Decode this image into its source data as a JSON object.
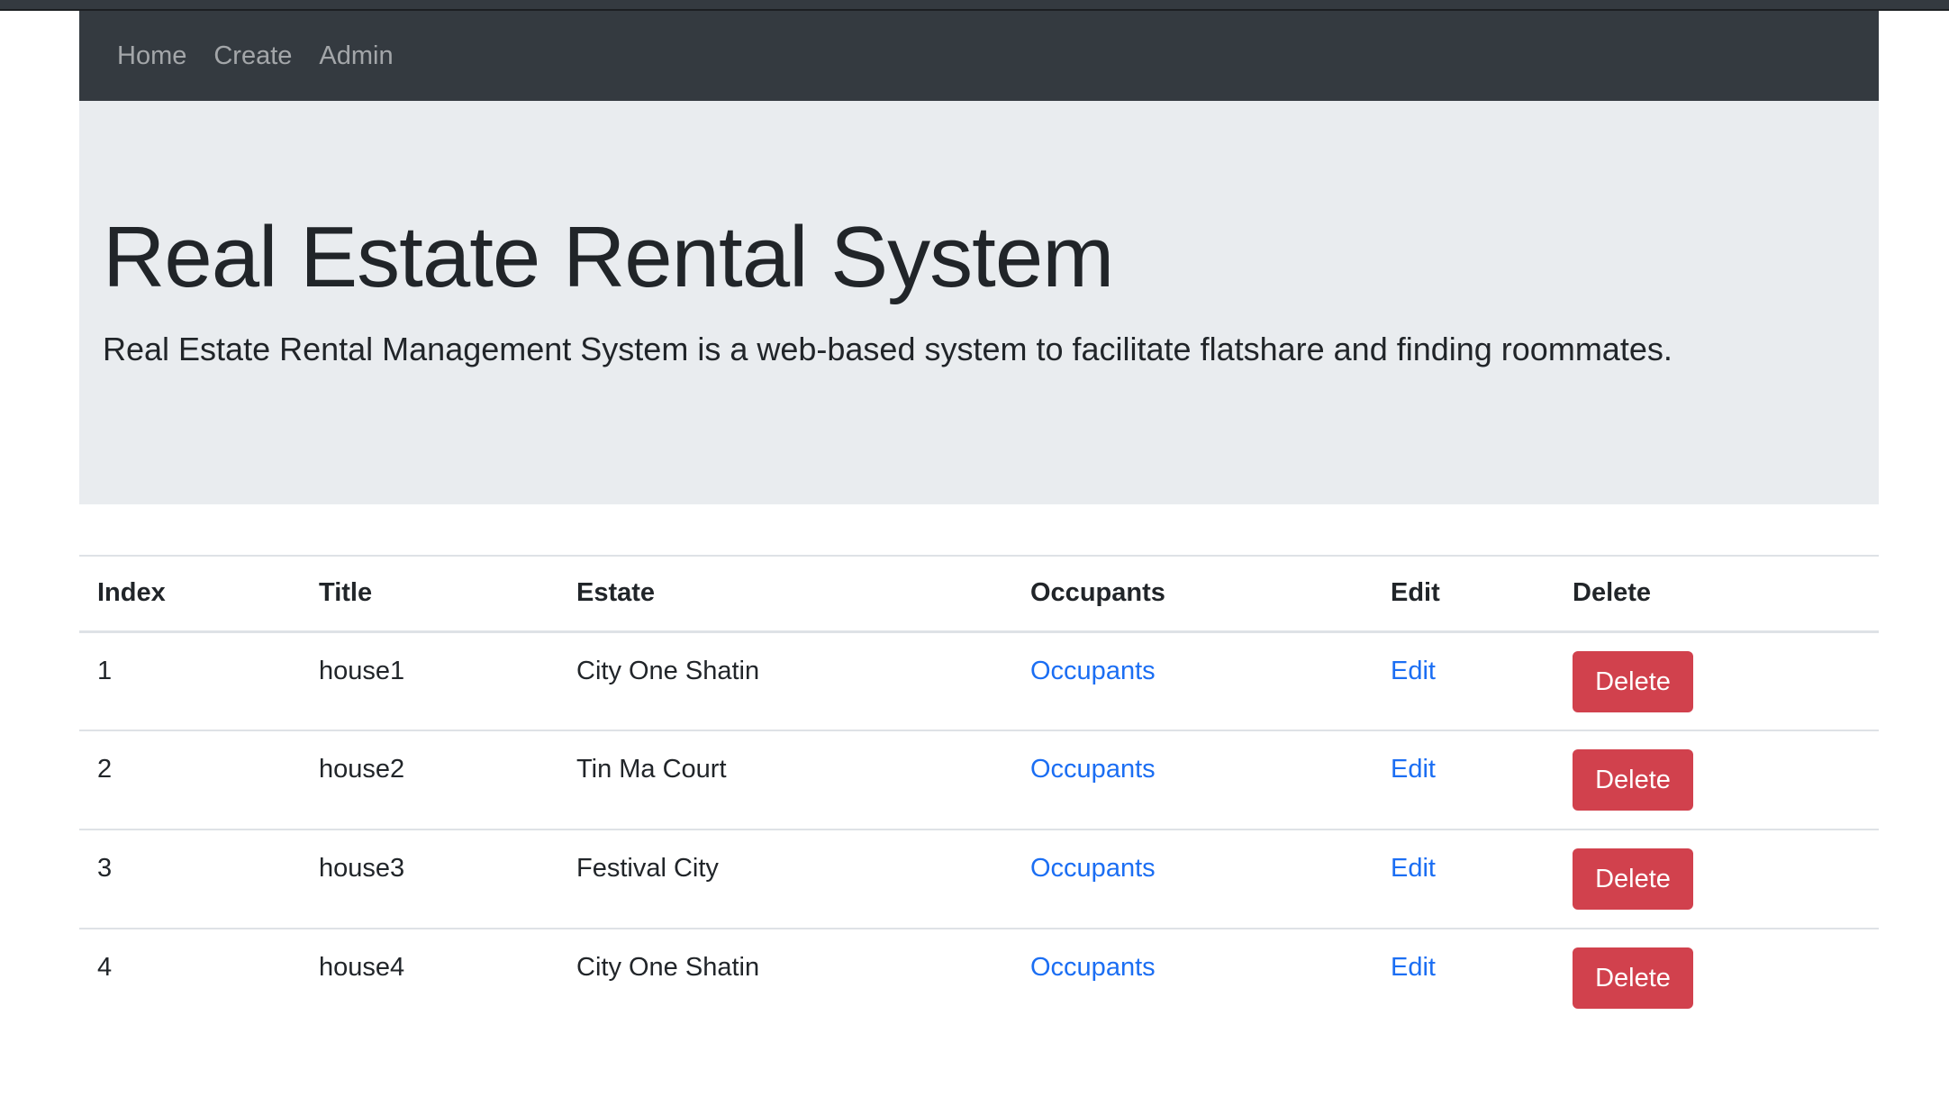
{
  "nav": {
    "items": [
      {
        "label": "Home"
      },
      {
        "label": "Create"
      },
      {
        "label": "Admin"
      }
    ]
  },
  "hero": {
    "title": "Real Estate Rental System",
    "description": "Real Estate Rental Management System is a web-based system to facilitate flatshare and finding roommates."
  },
  "table": {
    "headers": [
      "Index",
      "Title",
      "Estate",
      "Occupants",
      "Edit",
      "Delete"
    ],
    "rows": [
      {
        "index": "1",
        "title": "house1",
        "estate": "City One Shatin",
        "occupants_link": "Occupants",
        "edit_link": "Edit",
        "delete_label": "Delete"
      },
      {
        "index": "2",
        "title": "house2",
        "estate": "Tin Ma Court",
        "occupants_link": "Occupants",
        "edit_link": "Edit",
        "delete_label": "Delete"
      },
      {
        "index": "3",
        "title": "house3",
        "estate": "Festival City",
        "occupants_link": "Occupants",
        "edit_link": "Edit",
        "delete_label": "Delete"
      },
      {
        "index": "4",
        "title": "house4",
        "estate": "City One Shatin",
        "occupants_link": "Occupants",
        "edit_link": "Edit",
        "delete_label": "Delete"
      }
    ]
  },
  "colors": {
    "navbar": "#343a40",
    "jumbotron": "#e9ecef",
    "link": "#1b6ef3",
    "danger": "#d1414d"
  }
}
